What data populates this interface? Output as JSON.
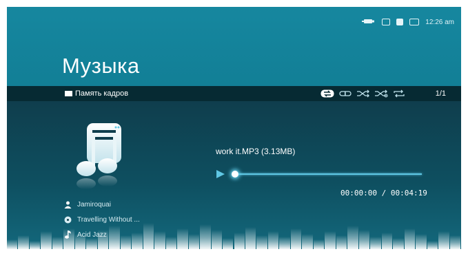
{
  "status_bar": {
    "icons": [
      "usb-icon",
      "card-icon",
      "sd-card-icon",
      "battery-icon"
    ],
    "time": "12:26 am"
  },
  "header": {
    "title": "Музыка"
  },
  "toolbar": {
    "source": "Память кадров",
    "repeat_modes": [
      "repeat-all-icon",
      "repeat-one-icon",
      "shuffle-icon",
      "shuffle-repeat-icon",
      "repeat-icon"
    ],
    "active_mode": 0,
    "counter": "1/1"
  },
  "track": {
    "artist": "Jamiroquai",
    "album": "Travelling Without ...",
    "genre": "Acid Jazz",
    "file": "work it.MP3 (3.13MB)",
    "time": "00:00:00 / 00:04:19",
    "progress": 0.0
  },
  "colors": {
    "accent": "#5fc7e4",
    "header": "#16879f",
    "toolbar": "#062a33"
  }
}
